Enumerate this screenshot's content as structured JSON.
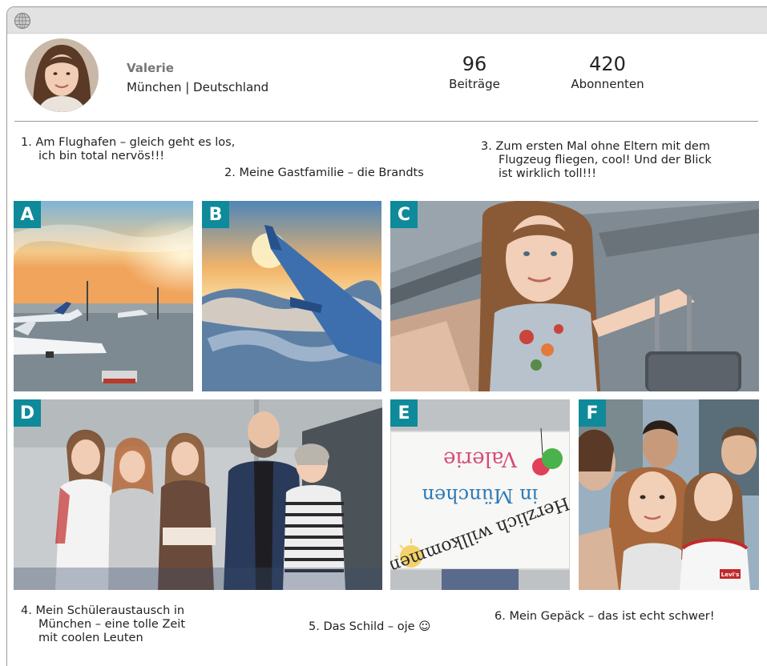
{
  "profile": {
    "name": "Valerie",
    "location": "München | Deutschland"
  },
  "stats": [
    {
      "number": "96",
      "label": "Beiträge"
    },
    {
      "number": "420",
      "label": "Abonnenten"
    }
  ],
  "captions": [
    {
      "num": "1.",
      "line1": "Am Flughafen – gleich geht es los,",
      "line2": "ich bin total nervös!!!"
    },
    {
      "num": "2.",
      "line1": "Meine Gastfamilie – die Brandts"
    },
    {
      "num": "3.",
      "line1": "Zum ersten Mal ohne Eltern mit dem",
      "line2": "Flugzeug fliegen, cool! Und der Blick",
      "line3": "ist wirklich toll!!!"
    },
    {
      "num": "4.",
      "line1": "Mein Schüleraustausch in",
      "line2": "München – eine tolle Zeit",
      "line3": "mit coolen Leuten"
    },
    {
      "num": "5.",
      "line1": "Das Schild – oje ☺"
    },
    {
      "num": "6.",
      "line1": "Mein Gepäck – das ist echt schwer!"
    }
  ],
  "photos": [
    {
      "letter": "A"
    },
    {
      "letter": "B"
    },
    {
      "letter": "C"
    },
    {
      "letter": "D"
    },
    {
      "letter": "E",
      "banner": {
        "line1": "Valerie",
        "line2": "in München",
        "line3": "Herzlich willkommen"
      }
    },
    {
      "letter": "F",
      "shirt_brand": "Levi's"
    }
  ],
  "colors": {
    "letter_badge": "#0e8a9a",
    "titlebar": "#e2e2e2",
    "divider": "#9a9a9a"
  },
  "icons": {
    "titlebar": "globe-icon"
  }
}
